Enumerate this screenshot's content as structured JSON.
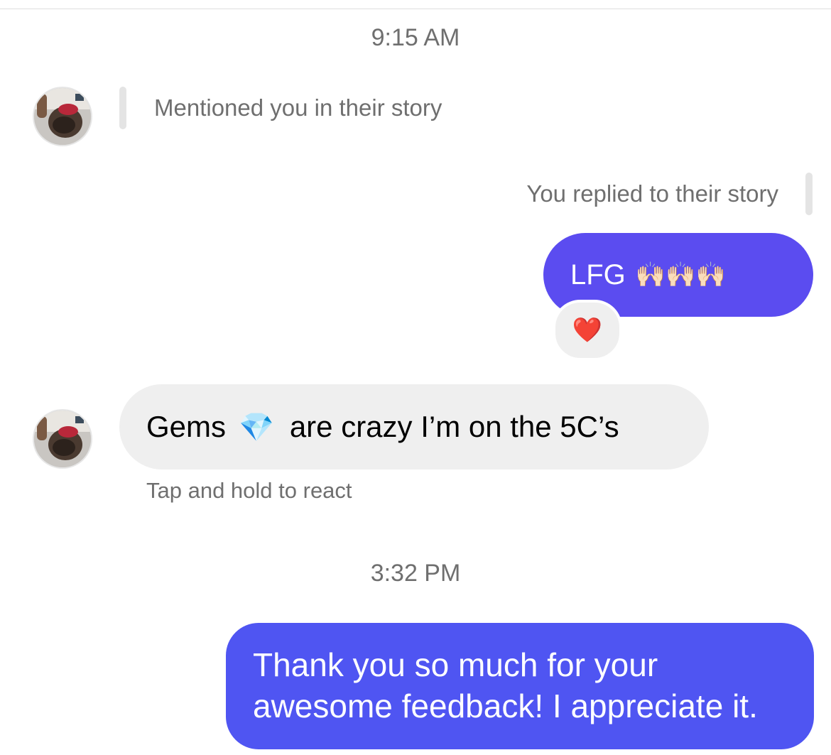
{
  "thread": {
    "timestamp_1": "9:15 AM",
    "timestamp_2": "3:32 PM"
  },
  "messages": [
    {
      "sender": "other",
      "type": "story_mention",
      "text": "Mentioned you in their story",
      "avatar_icon": "user-avatar"
    },
    {
      "sender": "me",
      "type": "story_reply_note",
      "text": "You replied to their story"
    },
    {
      "sender": "me",
      "type": "text",
      "text": "LFG",
      "emoji": "🙌🏻🙌🏻🙌🏻",
      "reaction": "❤️"
    },
    {
      "sender": "other",
      "type": "text",
      "text_before": "Gems",
      "emoji": "💎",
      "text_after": "are crazy I’m on the 5C’s",
      "hint": "Tap and hold to react",
      "avatar_icon": "user-avatar"
    },
    {
      "sender": "me",
      "type": "text",
      "line_1": "Thank you so much for your",
      "line_2": "awesome feedback! I appreciate it."
    }
  ],
  "colors": {
    "outgoing_bubble_1": "#5b4cf0",
    "outgoing_bubble_2": "#4f55f2",
    "incoming_bubble": "#efefef",
    "meta_text": "#6f6f6f"
  }
}
